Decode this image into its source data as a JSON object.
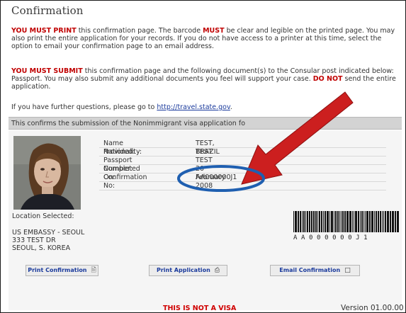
{
  "page": {
    "title": "Confirmation",
    "must_print": {
      "bold1": "YOU MUST PRINT",
      "text1": " this confirmation page. The barcode ",
      "bold2": "MUST",
      "text2": " be clear and legible on the printed page. You may also print the entire application for your records. If you do not have access to a printer at this time, select the option to email your confirmation page to an email address."
    },
    "must_submit": {
      "bold1": "YOU MUST SUBMIT",
      "text1": " this confirmation page and the following document(s) to the Consular post indicated below: Passport. You may also submit any additional documents you feel will support your case. ",
      "bold2": "DO NOT",
      "text2": " send the entire application."
    },
    "questions": {
      "text": "If you have further questions, please go to ",
      "link": "http://travel.state.gov",
      "end": "."
    },
    "confirms_text": "This confirms the submission of the Nonimmigrant visa application fo"
  },
  "applicant": {
    "rows": [
      {
        "label": "Name Provided:",
        "value": "TEST, TEST"
      },
      {
        "label": "Nationality:",
        "value": "BRAZIL"
      },
      {
        "label": "Passport Number:",
        "value": "TEST"
      },
      {
        "label": "Completed On:",
        "value": "20 February 2008"
      },
      {
        "label": "Confirmation No:",
        "value": "AA000000J1"
      }
    ]
  },
  "location": {
    "label": "Location Selected:",
    "line1": "US EMBASSY - SEOUL",
    "line2": "333 TEST DR",
    "line3": "SEOUL, S. KOREA"
  },
  "barcode": {
    "text": "AA000000J1"
  },
  "buttons": {
    "print_confirmation": "Print Confirmation",
    "print_application": "Print Application",
    "email_confirmation": "Email Confirmation"
  },
  "footer": {
    "not_visa": "THIS IS NOT A VISA",
    "version": "Version 01.00.00"
  },
  "colors": {
    "red_text": "#c00000",
    "link": "#1a3a9c",
    "annotation_arrow": "#cc1f1f",
    "annotation_ellipse": "#1f5fb0"
  }
}
